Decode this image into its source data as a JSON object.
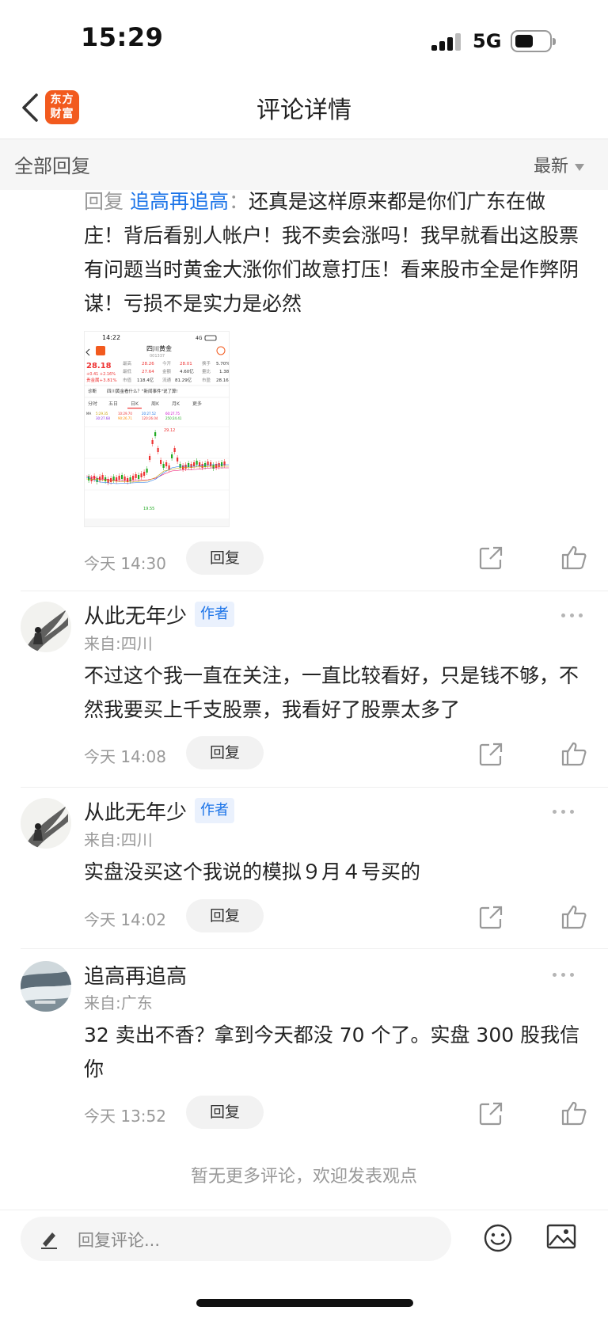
{
  "status": {
    "time": "15:29",
    "network": "5G"
  },
  "nav": {
    "logo_line1": "东方",
    "logo_line2": "财富",
    "title": "评论详情"
  },
  "replies_header": {
    "label": "全部回复",
    "sort": "最新"
  },
  "first_reply": {
    "prefix": "回复 ",
    "reply_to": "追高再追高",
    "colon": "：",
    "text": "还真是这样原来都是你们广东在做庄！背后看别人帐户！我不卖会涨吗！我早就看出这股票有问题当时黄金大涨你们故意打压！看来股市全是作弊阴谋！亏损不是实力是必然",
    "time": "今天 14:30",
    "reply_label": "回复",
    "screenshot": {
      "time": "14:22",
      "net": "4G",
      "stock_name": "四川黄金",
      "stock_code": "001337",
      "price": "28.18",
      "change": "+0.41 +2.16%",
      "row1": [
        "最高",
        "28.26",
        "今开",
        "28.01",
        "换手",
        "5.70%"
      ],
      "row2": [
        "最低",
        "27.64",
        "金额",
        "4.60亿",
        "量比",
        "1.38"
      ],
      "row3": [
        "贵金属+3.81%",
        "市值",
        "118.4亿",
        "流通",
        "81.29亿",
        "市盈",
        "28.16"
      ],
      "question": "四川黄金看什么？\"新闻事件\"说了算!",
      "diag_label": "诊断",
      "tabs": [
        "分时",
        "五日",
        "日K",
        "周K",
        "月K",
        "更多"
      ],
      "peak_label": "29.12",
      "low_label": "19.55"
    }
  },
  "comments": [
    {
      "user": "从此无年少",
      "tag": "作者",
      "from": "来自:四川",
      "text": "不过这个我一直在关注，一直比较看好，只是钱不够，不然我要买上千支股票，我看好了股票太多了",
      "time": "今天 14:08",
      "reply_label": "回复"
    },
    {
      "user": "从此无年少",
      "tag": "作者",
      "from": "来自:四川",
      "text": "实盘没买这个我说的模拟９月４号买的",
      "time": "今天 14:02",
      "reply_label": "回复"
    },
    {
      "user": "追高再追高",
      "tag": "",
      "from": "来自:广东",
      "text": "32 卖出不香？拿到今天都没 70 个了。实盘 300 股我信你",
      "time": "今天 13:52",
      "reply_label": "回复"
    }
  ],
  "footer": {
    "no_more": "暂无更多评论，欢迎发表观点",
    "input_placeholder": "回复评论..."
  }
}
